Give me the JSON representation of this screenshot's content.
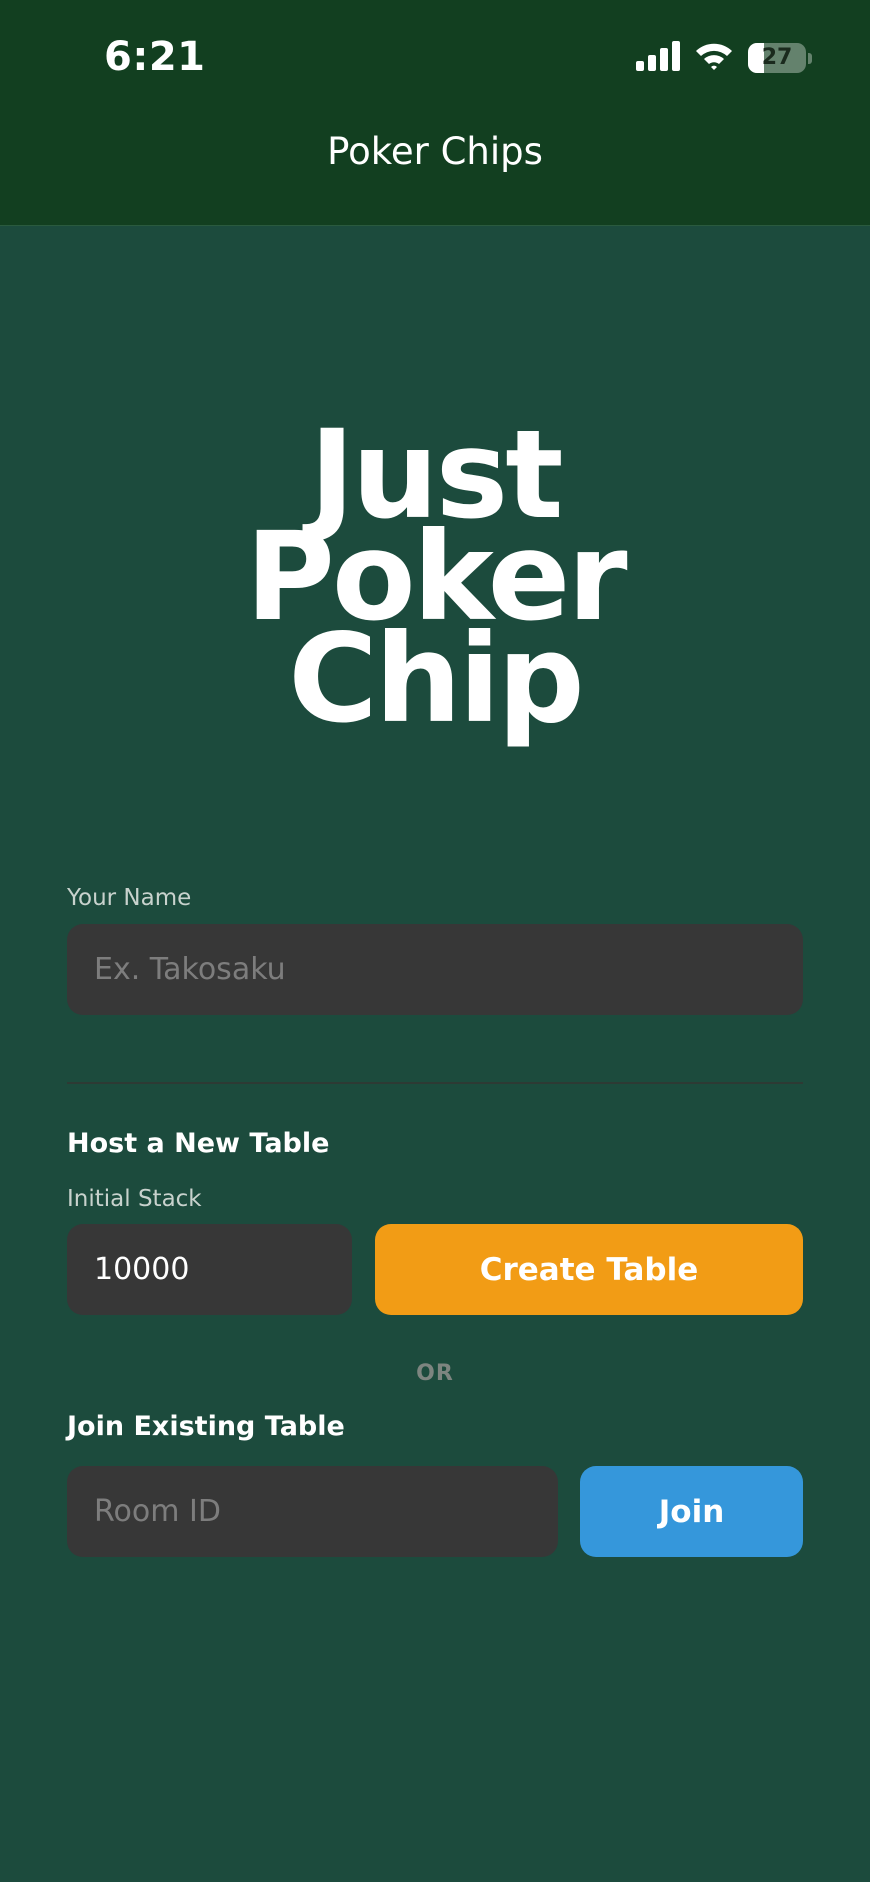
{
  "status_bar": {
    "time": "6:21",
    "battery_level": "27",
    "signal_icon": "cellular-signal-icon",
    "wifi_icon": "wifi-icon"
  },
  "header": {
    "title": "Poker Chips"
  },
  "logo": {
    "lines": [
      "Just",
      "Poker",
      "Chip"
    ]
  },
  "name_field": {
    "label": "Your Name",
    "placeholder": "Ex. Takosaku",
    "value": ""
  },
  "host_section": {
    "title": "Host a New Table",
    "stack_label": "Initial Stack",
    "stack_value": "10000",
    "create_button": "Create Table"
  },
  "separator_text": "OR",
  "join_section": {
    "title": "Join Existing Table",
    "room_placeholder": "Room ID",
    "room_value": "",
    "join_button": "Join"
  },
  "colors": {
    "background": "#1c4b3d",
    "header": "#123f20",
    "input": "#373737",
    "create_button": "#f29c15",
    "join_button": "#3597db"
  }
}
